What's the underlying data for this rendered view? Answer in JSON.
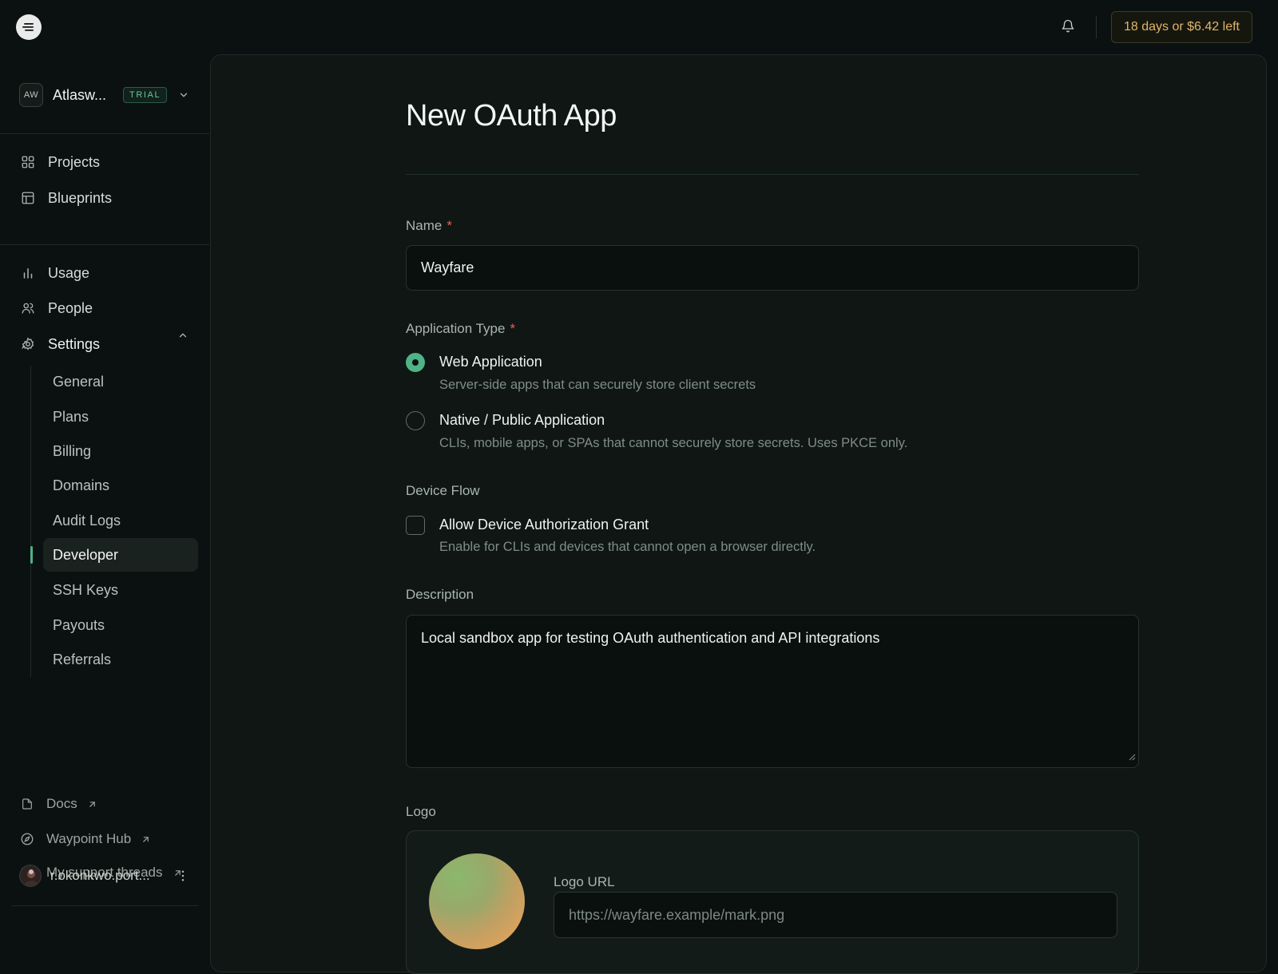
{
  "topbar": {
    "trial_left": "18 days or $6.42 left"
  },
  "org": {
    "initials": "AW",
    "name": "Atlasw...",
    "badge": "TRIAL"
  },
  "nav": {
    "projects": "Projects",
    "blueprints": "Blueprints",
    "usage": "Usage",
    "people": "People",
    "settings": "Settings"
  },
  "settings_items": {
    "general": "General",
    "plans": "Plans",
    "billing": "Billing",
    "domains": "Domains",
    "audit_logs": "Audit Logs",
    "developer": "Developer",
    "ssh_keys": "SSH Keys",
    "payouts": "Payouts",
    "referrals": "Referrals"
  },
  "footer": {
    "docs": "Docs",
    "waypoint_hub": "Waypoint Hub",
    "support": "My support threads",
    "user": "r.okonkwo.port..."
  },
  "form": {
    "title": "New OAuth App",
    "name_label": "Name",
    "required_mark": "*",
    "name_value": "Wayfare",
    "app_type_label": "Application Type",
    "web_title": "Web Application",
    "web_desc": "Server-side apps that can securely store client secrets",
    "native_title": "Native / Public Application",
    "native_desc": "CLIs, mobile apps, or SPAs that cannot securely store secrets. Uses PKCE only.",
    "device_flow_label": "Device Flow",
    "device_title": "Allow Device Authorization Grant",
    "device_desc": "Enable for CLIs and devices that cannot open a browser directly.",
    "description_label": "Description",
    "description_value": "Local sandbox app for testing OAuth authentication and API integrations",
    "logo_label": "Logo",
    "logo_url_label": "Logo URL",
    "logo_url_placeholder": "https://wayfare.example/mark.png"
  },
  "colors": {
    "accent": "#4fb387",
    "required": "#e0645a",
    "trial_text": "#e2b469"
  },
  "selected_app_type": "Web Application",
  "device_grant_checked": false
}
